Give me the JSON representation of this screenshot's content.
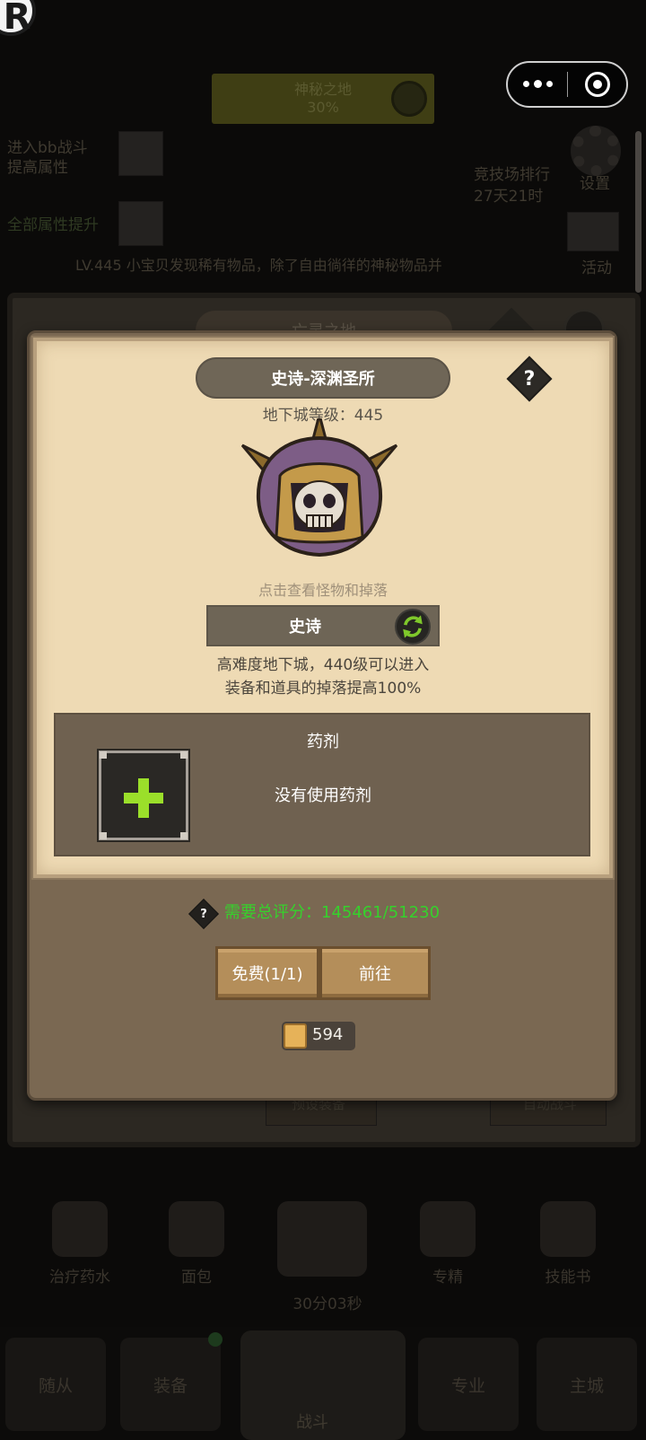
{
  "background": {
    "banner_title": "神秘之地",
    "banner_sub": "30%",
    "left_line1": "进入bb战斗",
    "left_line2": "提高属性",
    "left_line3": "全部属性提升",
    "right_line1": "竞技场排行",
    "right_line2": "27天21时",
    "settings_label": "设置",
    "activity_label": "活动",
    "ticker": "LV.445 小宝贝发现稀有物品，除了自由徜徉的神秘物品并",
    "panel_title": "亡灵之地",
    "under_left": "预设装备",
    "under_right": "自动战斗",
    "bottom_items": [
      "治疗药水",
      "面包",
      "",
      "专精",
      "技能书"
    ],
    "timer": "30分03秒",
    "nav": [
      "随从",
      "装备",
      "战斗",
      "专业",
      "主城"
    ]
  },
  "miniprogram": {
    "logo_letter": "R"
  },
  "modal": {
    "title": "史诗-深渊圣所",
    "help": "?",
    "dungeon_level": "地下城等级：445",
    "monster_hint": "点击查看怪物和掉落",
    "difficulty": "史诗",
    "desc_line1": "高难度地下城，440级可以进入",
    "desc_line2": "装备和道具的掉落提高100%",
    "potion_label": "药剂",
    "potion_status": "没有使用药剂",
    "req_help": "?",
    "requirement": "需要总评分：145461/51230",
    "btn_free": "免费(1/1)",
    "btn_go": "前往",
    "scroll_count": "594"
  },
  "colors": {
    "parchment": "#eedab4",
    "requirement_green": "#36d12c",
    "plus_green": "#9bdf2a",
    "wood_button": "#b48e5a"
  }
}
